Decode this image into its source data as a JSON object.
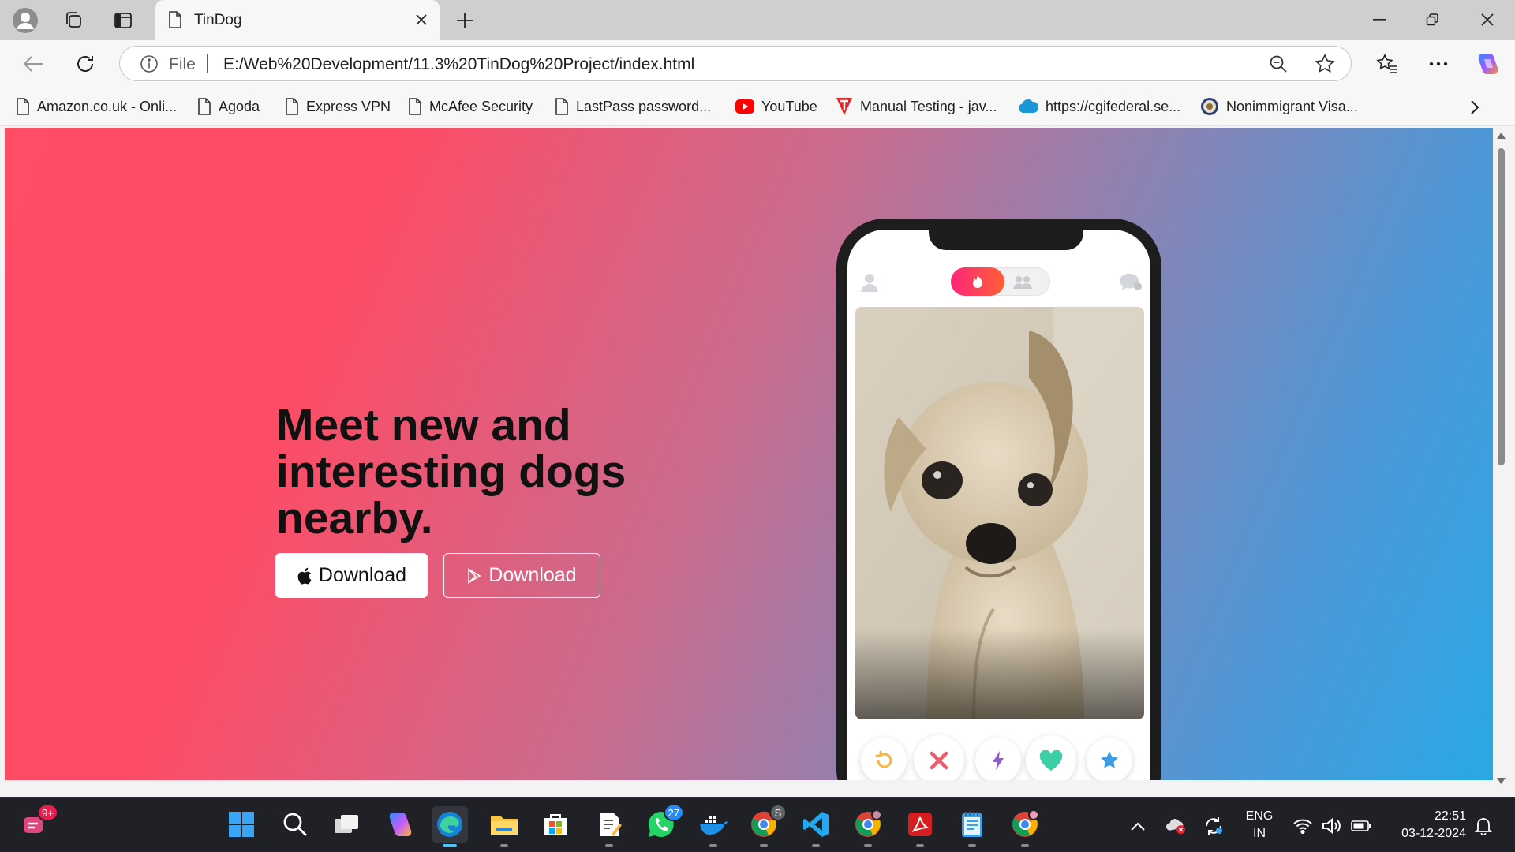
{
  "browser": {
    "tab": {
      "title": "TinDog"
    },
    "omnibox": {
      "scheme_label": "File",
      "url": "E:/Web%20Development/11.3%20TinDog%20Project/index.html"
    },
    "bookmarks": [
      {
        "label": "Amazon.co.uk - Onli...",
        "icon": "page-icon"
      },
      {
        "label": "Agoda",
        "icon": "page-icon"
      },
      {
        "label": "Express VPN",
        "icon": "page-icon"
      },
      {
        "label": "McAfee Security",
        "icon": "page-icon"
      },
      {
        "label": "LastPass password...",
        "icon": "page-icon"
      },
      {
        "label": "YouTube",
        "icon": "youtube-icon"
      },
      {
        "label": "Manual Testing - jav...",
        "icon": "testing-logo-icon"
      },
      {
        "label": "https://cgifederal.se...",
        "icon": "salesforce-cloud-icon"
      },
      {
        "label": "Nonimmigrant Visa...",
        "icon": "state-seal-icon"
      }
    ]
  },
  "page": {
    "hero_title": "Meet new and interesting dogs nearby.",
    "download_apple_label": "Download",
    "download_play_label": "Download",
    "colors": {
      "gradient_start": "#ff4b65",
      "gradient_end": "#2aa8e6",
      "accent": "#fd267a"
    }
  },
  "taskbar": {
    "notifications_badge": "9+",
    "whatsapp_badge": "27",
    "docker_badge": "S",
    "language_line1": "ENG",
    "language_line2": "IN",
    "time": "22:51",
    "date": "03-12-2024"
  }
}
